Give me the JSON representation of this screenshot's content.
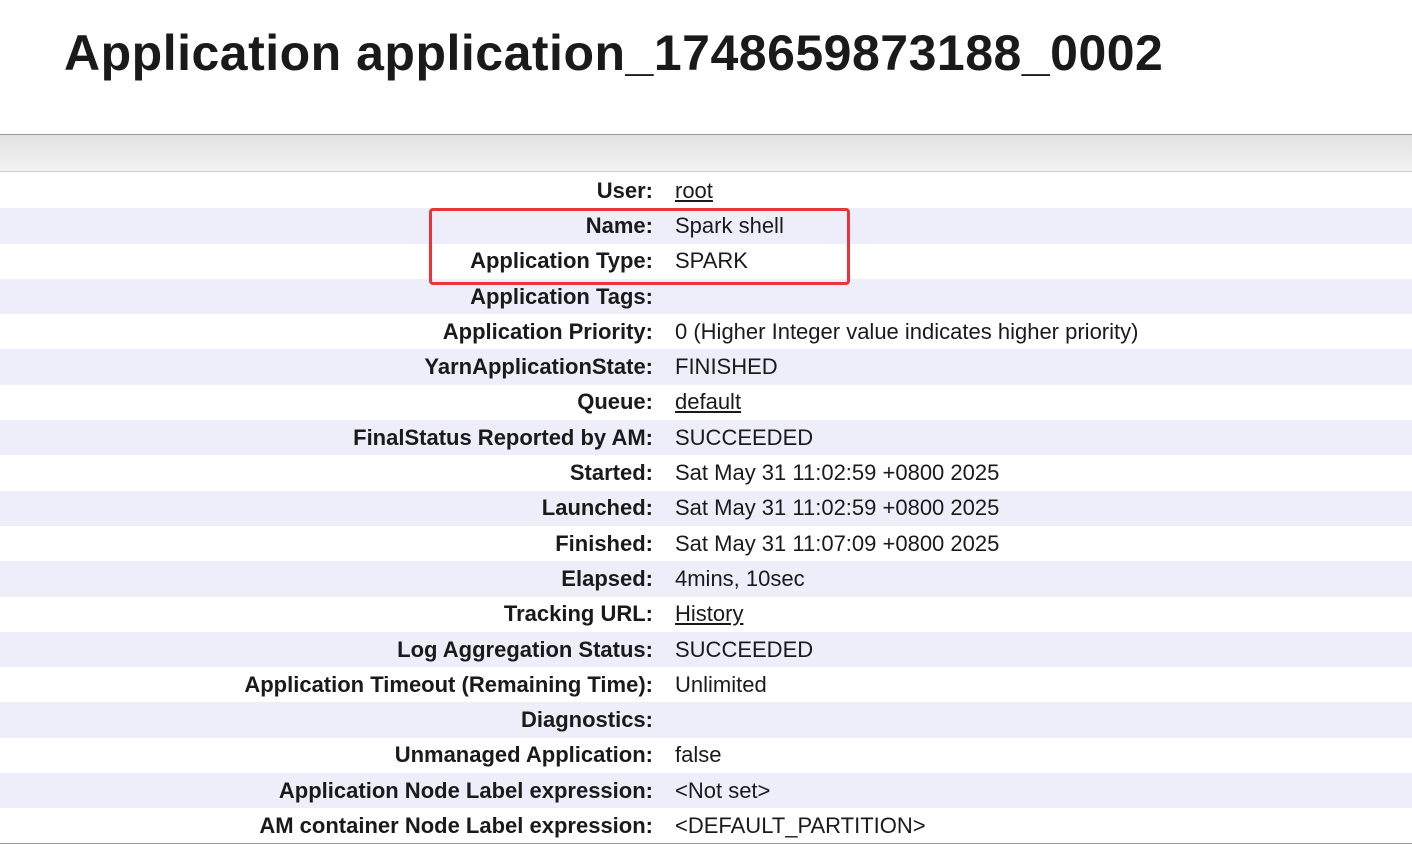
{
  "page_title": "Application application_1748659873188_0002",
  "rows": [
    {
      "label": "User:",
      "value": "root",
      "link": true
    },
    {
      "label": "Name:",
      "value": "Spark shell",
      "link": false
    },
    {
      "label": "Application Type:",
      "value": "SPARK",
      "link": false
    },
    {
      "label": "Application Tags:",
      "value": "",
      "link": false
    },
    {
      "label": "Application Priority:",
      "value": "0 (Higher Integer value indicates higher priority)",
      "link": false
    },
    {
      "label": "YarnApplicationState:",
      "value": "FINISHED",
      "link": false
    },
    {
      "label": "Queue:",
      "value": "default",
      "link": true
    },
    {
      "label": "FinalStatus Reported by AM:",
      "value": "SUCCEEDED",
      "link": false
    },
    {
      "label": "Started:",
      "value": "Sat May 31 11:02:59 +0800 2025",
      "link": false
    },
    {
      "label": "Launched:",
      "value": "Sat May 31 11:02:59 +0800 2025",
      "link": false
    },
    {
      "label": "Finished:",
      "value": "Sat May 31 11:07:09 +0800 2025",
      "link": false
    },
    {
      "label": "Elapsed:",
      "value": "4mins, 10sec",
      "link": false
    },
    {
      "label": "Tracking URL:",
      "value": "History",
      "link": true
    },
    {
      "label": "Log Aggregation Status:",
      "value": "SUCCEEDED",
      "link": false
    },
    {
      "label": "Application Timeout (Remaining Time):",
      "value": "Unlimited",
      "link": false
    },
    {
      "label": "Diagnostics:",
      "value": "",
      "link": false
    },
    {
      "label": "Unmanaged Application:",
      "value": "false",
      "link": false
    },
    {
      "label": "Application Node Label expression:",
      "value": "<Not set>",
      "link": false
    },
    {
      "label": "AM container Node Label expression:",
      "value": "<DEFAULT_PARTITION>",
      "link": false
    }
  ],
  "colors": {
    "highlight_border": "#e8343a",
    "row_stripe": "#eeeefa"
  }
}
